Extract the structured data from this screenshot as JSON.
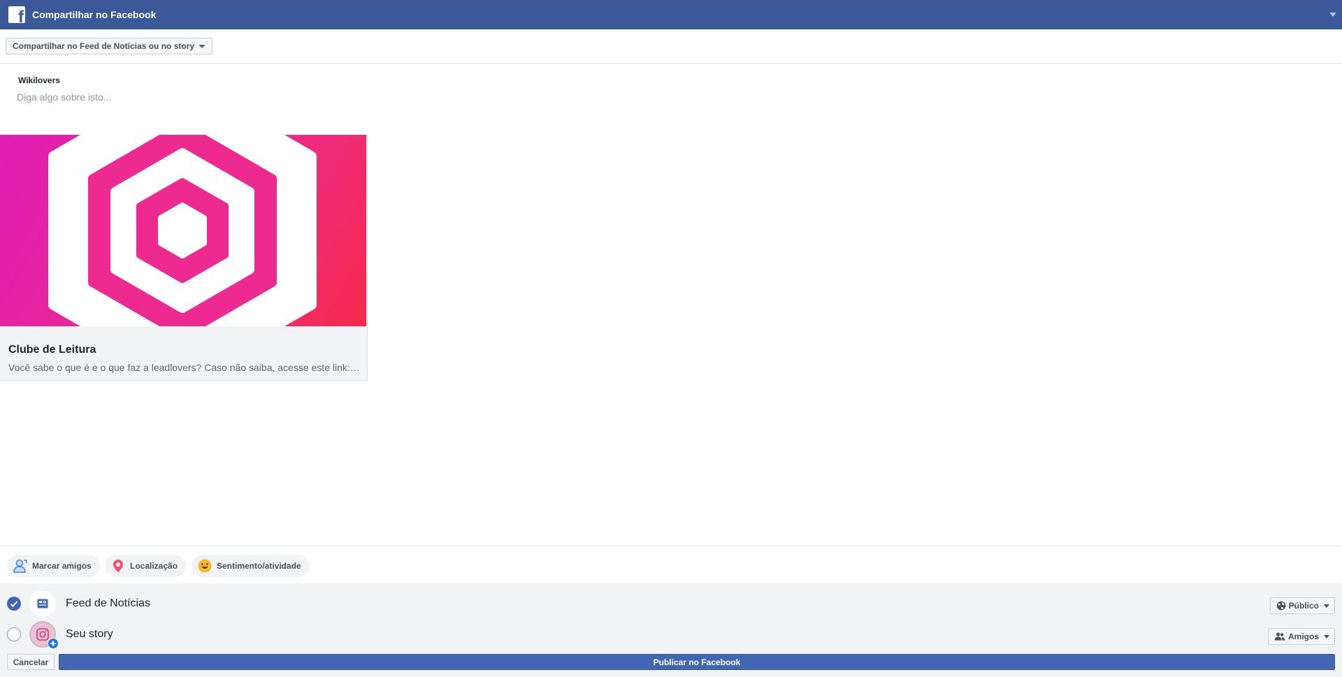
{
  "header": {
    "title": "Compartilhar no Facebook",
    "logo_icon": "facebook-f-icon",
    "menu_icon": "caret-down-icon",
    "background": "#3b5998"
  },
  "share_target_select": {
    "selected": "Compartilhar no Feed de Notícias ou no story"
  },
  "composer": {
    "author": "Wikilovers",
    "placeholder": "Diga algo sobre isto...",
    "value": ""
  },
  "link_preview": {
    "title": "Clube de Leitura",
    "description": "Você sabe o que é e o que faz a leadlovers? Caso não saiba, acesse este link: https://leadlovers.com/",
    "image_icon": "leadlovers-hexagon-logo",
    "image_gradient": [
      "#e01cb4",
      "#ec2a90",
      "#f52a4a"
    ]
  },
  "actions": [
    {
      "label": "Marcar amigos",
      "icon": "tag-friends-icon"
    },
    {
      "label": "Localização",
      "icon": "location-pin-icon"
    },
    {
      "label": "Sentimento/atividade",
      "icon": "smiley-icon"
    }
  ],
  "destinations": [
    {
      "label": "Feed de Notícias",
      "checked": true,
      "icon": "news-feed-icon",
      "audience": "Público",
      "audience_icon": "globe-icon"
    },
    {
      "label": "Seu story",
      "checked": false,
      "icon": "story-camera-icon",
      "audience": "Amigos",
      "audience_icon": "friends-icon"
    }
  ],
  "footer": {
    "cancel_label": "Cancelar",
    "publish_label": "Publicar no Facebook",
    "accent": "#4267b2"
  }
}
